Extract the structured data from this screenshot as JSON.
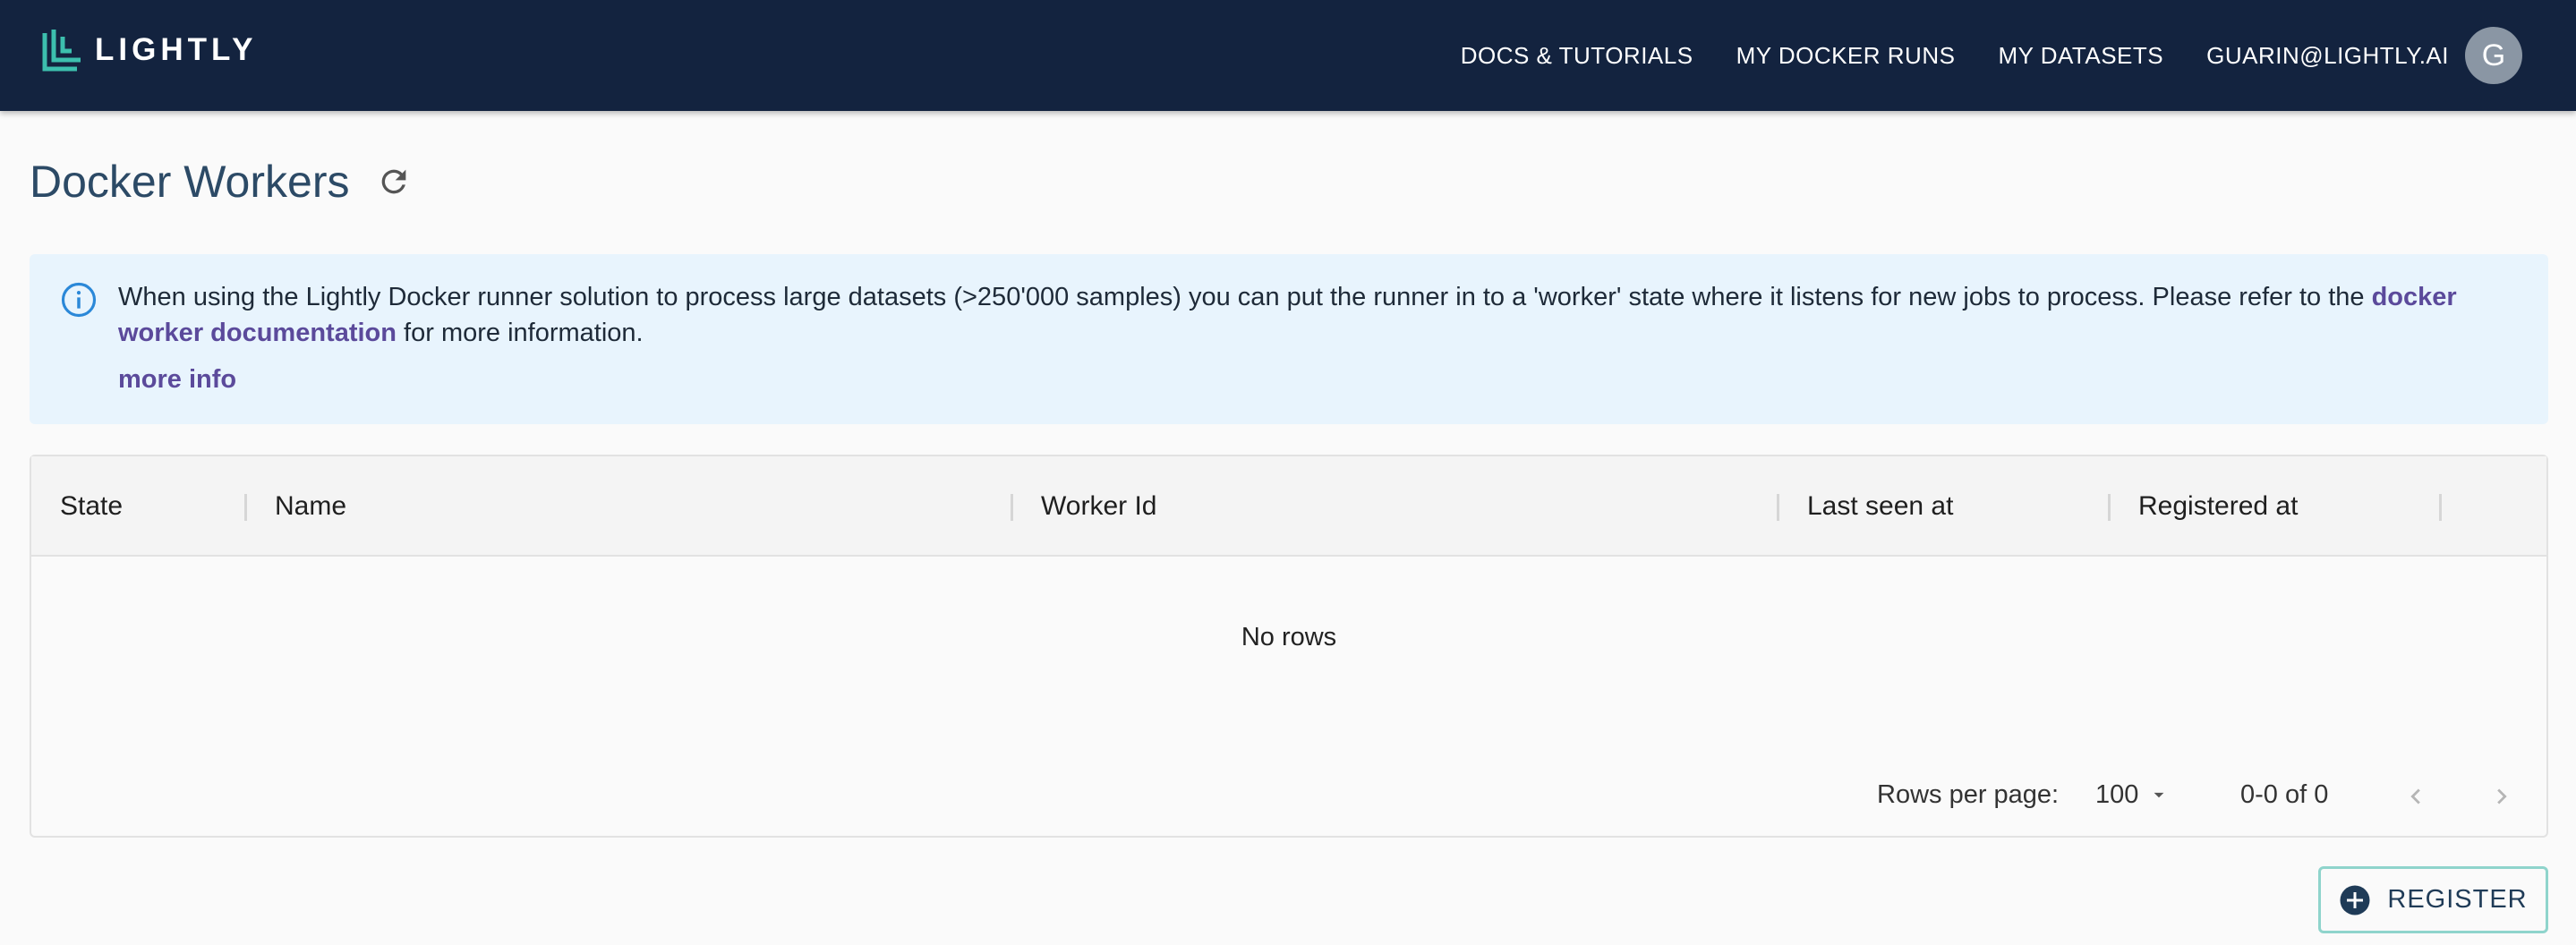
{
  "brand": {
    "name": "LIGHTLY",
    "accent": "#3cbfae"
  },
  "nav": {
    "docs": "DOCS & TUTORIALS",
    "runs": "MY DOCKER RUNS",
    "datasets": "MY DATASETS",
    "user": "GUARIN@LIGHTLY.AI",
    "avatar_initial": "G"
  },
  "page": {
    "title": "Docker Workers"
  },
  "alert": {
    "text_before": "When using the Lightly Docker runner solution to process large datasets (>250'000 samples) you can put the runner in to a 'worker' state where it listens for new jobs to process. Please refer to the ",
    "link_text": "docker worker documentation",
    "text_after": " for more information.",
    "more_info": "more info"
  },
  "table": {
    "columns": [
      "State",
      "Name",
      "Worker Id",
      "Last seen at",
      "Registered at"
    ],
    "empty_text": "No rows",
    "rows_per_page_label": "Rows per page:",
    "rows_per_page_value": "100",
    "range": "0-0 of 0"
  },
  "register_button": {
    "label": "REGISTER"
  }
}
